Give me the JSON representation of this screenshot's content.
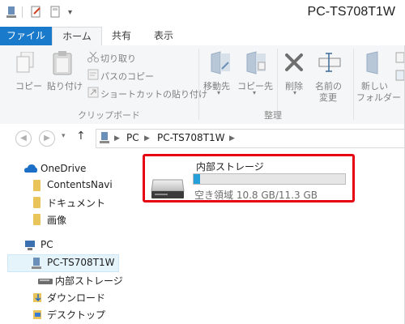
{
  "window": {
    "title": "PC-TS708T1W"
  },
  "ribbon": {
    "tabs": [
      {
        "label": "ファイル"
      },
      {
        "label": "ホーム"
      },
      {
        "label": "共有"
      },
      {
        "label": "表示"
      }
    ],
    "clipboard": {
      "copy": "コピー",
      "paste": "貼り付け",
      "cut": "切り取り",
      "copy_path": "パスのコピー",
      "paste_shortcut": "ショートカットの貼り付け",
      "group_label": "クリップボード"
    },
    "organize": {
      "move_to": "移動先",
      "copy_to": "コピー先",
      "delete": "削除",
      "rename_line1": "名前の",
      "rename_line2": "変更",
      "group_label": "整理"
    },
    "new": {
      "new_folder_line1": "新しい",
      "new_folder_line2": "フォルダー"
    }
  },
  "address": {
    "crumbs": [
      "PC",
      "PC-TS708T1W"
    ]
  },
  "nav": {
    "items": [
      {
        "label": "OneDrive"
      },
      {
        "label": "ContentsNavi"
      },
      {
        "label": "ドキュメント"
      },
      {
        "label": "画像"
      },
      {
        "label": "PC"
      },
      {
        "label": "PC-TS708T1W"
      },
      {
        "label": "内部ストレージ"
      },
      {
        "label": "ダウンロード"
      },
      {
        "label": "デスクトップ"
      }
    ]
  },
  "drive": {
    "name": "内部ストレージ",
    "free_text": "空き領域 10.8 GB/11.3 GB",
    "used_fraction": 0.044,
    "bar_color": "#26a0da"
  },
  "colors": {
    "accent": "#1979ca",
    "highlight": "#e60012"
  }
}
